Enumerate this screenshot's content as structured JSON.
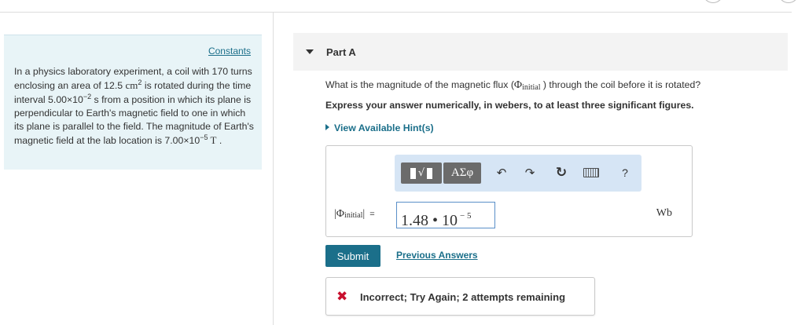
{
  "problem": {
    "constants_label": "Constants",
    "text_part1": "In a physics laboratory experiment, a coil with 170 turns enclosing an area of 12.5 ",
    "area_unit": "cm",
    "area_exp": "2",
    "text_part2": " is rotated during the time interval 5.00×10",
    "time_exp": "−2",
    "text_part3": " s from a position in which its plane is perpendicular to Earth's magnetic field to one in which its plane is parallel to the field. The magnitude of Earth's magnetic field at the lab location is 7.00×10",
    "field_exp": "−5",
    "field_unit": " T",
    "text_end": " ."
  },
  "part": {
    "title": "Part A"
  },
  "question": {
    "text_before": "What is the magnitude of the magnetic flux (",
    "phi": "Φ",
    "phi_sub": "initial",
    "text_after": " ) through the coil before it is rotated?",
    "instruction": "Express your answer numerically, in webers, to at least three significant figures.",
    "hints_label": "View Available Hint(s)"
  },
  "toolbar": {
    "templates_glyph": "√",
    "greek_label": "ΑΣφ",
    "undo_glyph": "↶",
    "redo_glyph": "↷",
    "reset_glyph": "↻",
    "help_label": "?"
  },
  "answer": {
    "label_open": "|Φ",
    "label_sub": "initial",
    "label_close": "|",
    "equals": "=",
    "mantissa": "1.48 • 10",
    "exponent": "− 5",
    "unit": "Wb"
  },
  "actions": {
    "submit_label": "Submit",
    "previous_answers_label": "Previous Answers"
  },
  "feedback": {
    "icon": "✖",
    "message": "Incorrect; Try Again; 2 attempts remaining",
    "icon_color": "#c8102e"
  },
  "colors": {
    "accent": "#1b6f8a",
    "panel_bg": "#e8f4f7",
    "toolbar_bg": "#d6e5f5"
  }
}
